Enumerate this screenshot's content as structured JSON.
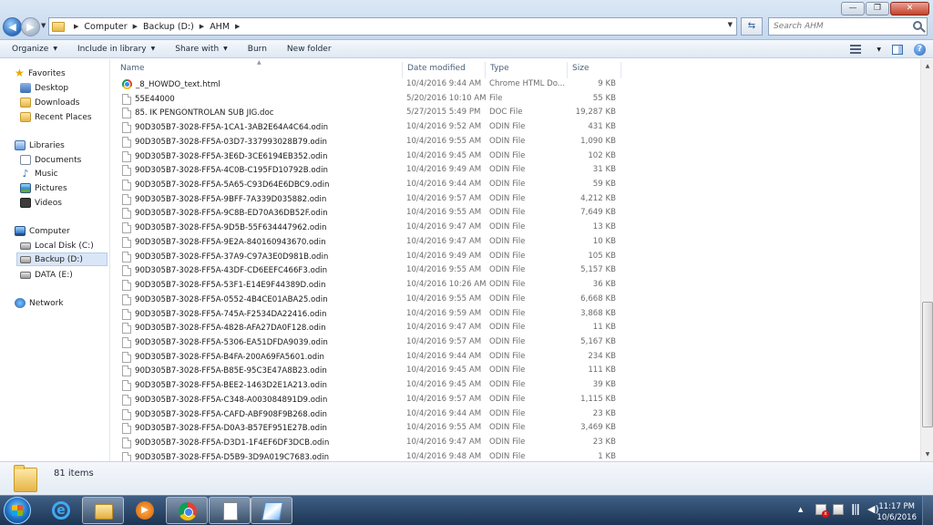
{
  "window": {
    "address_crumbs": [
      "Computer",
      "Backup (D:)",
      "AHM"
    ],
    "search_placeholder": "Search AHM",
    "controls": {
      "minimize": "—",
      "maximize": "❐",
      "close": "✕"
    }
  },
  "toolbar": {
    "organize": "Organize",
    "include_in_library": "Include in library",
    "share_with": "Share with",
    "burn": "Burn",
    "new_folder": "New folder",
    "help": "?"
  },
  "navpane": {
    "favorites": "Favorites",
    "desktop": "Desktop",
    "downloads": "Downloads",
    "recent_places": "Recent Places",
    "libraries": "Libraries",
    "documents": "Documents",
    "music": "Music",
    "pictures": "Pictures",
    "videos": "Videos",
    "computer": "Computer",
    "local_disk": "Local Disk (C:)",
    "backup": "Backup (D:)",
    "data": "DATA (E:)",
    "network": "Network"
  },
  "columns": {
    "name": "Name",
    "date": "Date modified",
    "type": "Type",
    "size": "Size"
  },
  "files": [
    {
      "name": "_8_HOWDO_text.html",
      "date": "10/4/2016 9:44 AM",
      "type": "Chrome HTML Do...",
      "size": "9 KB",
      "icon": "chrome-file-icon"
    },
    {
      "name": "55E44000",
      "date": "5/20/2016 10:10 AM",
      "type": "File",
      "size": "55 KB",
      "icon": "file-icon"
    },
    {
      "name": "85. IK PENGONTROLAN SUB JIG.doc",
      "date": "5/27/2015 5:49 PM",
      "type": "DOC File",
      "size": "19,287 KB",
      "icon": "file-icon"
    },
    {
      "name": "90D305B7-3028-FF5A-1CA1-3AB2E64A4C64.odin",
      "date": "10/4/2016 9:52 AM",
      "type": "ODIN File",
      "size": "431 KB",
      "icon": "file-icon"
    },
    {
      "name": "90D305B7-3028-FF5A-03D7-337993028B79.odin",
      "date": "10/4/2016 9:55 AM",
      "type": "ODIN File",
      "size": "1,090 KB",
      "icon": "file-icon"
    },
    {
      "name": "90D305B7-3028-FF5A-3E6D-3CE6194EB352.odin",
      "date": "10/4/2016 9:45 AM",
      "type": "ODIN File",
      "size": "102 KB",
      "icon": "file-icon"
    },
    {
      "name": "90D305B7-3028-FF5A-4C0B-C195FD10792B.odin",
      "date": "10/4/2016 9:49 AM",
      "type": "ODIN File",
      "size": "31 KB",
      "icon": "file-icon"
    },
    {
      "name": "90D305B7-3028-FF5A-5A65-C93D64E6DBC9.odin",
      "date": "10/4/2016 9:44 AM",
      "type": "ODIN File",
      "size": "59 KB",
      "icon": "file-icon"
    },
    {
      "name": "90D305B7-3028-FF5A-9BFF-7A339D035882.odin",
      "date": "10/4/2016 9:57 AM",
      "type": "ODIN File",
      "size": "4,212 KB",
      "icon": "file-icon"
    },
    {
      "name": "90D305B7-3028-FF5A-9C8B-ED70A36DB52F.odin",
      "date": "10/4/2016 9:55 AM",
      "type": "ODIN File",
      "size": "7,649 KB",
      "icon": "file-icon"
    },
    {
      "name": "90D305B7-3028-FF5A-9D5B-55F634447962.odin",
      "date": "10/4/2016 9:47 AM",
      "type": "ODIN File",
      "size": "13 KB",
      "icon": "file-icon"
    },
    {
      "name": "90D305B7-3028-FF5A-9E2A-840160943670.odin",
      "date": "10/4/2016 9:47 AM",
      "type": "ODIN File",
      "size": "10 KB",
      "icon": "file-icon"
    },
    {
      "name": "90D305B7-3028-FF5A-37A9-C97A3E0D981B.odin",
      "date": "10/4/2016 9:49 AM",
      "type": "ODIN File",
      "size": "105 KB",
      "icon": "file-icon"
    },
    {
      "name": "90D305B7-3028-FF5A-43DF-CD6EEFC466F3.odin",
      "date": "10/4/2016 9:55 AM",
      "type": "ODIN File",
      "size": "5,157 KB",
      "icon": "file-icon"
    },
    {
      "name": "90D305B7-3028-FF5A-53F1-E14E9F44389D.odin",
      "date": "10/4/2016 10:26 AM",
      "type": "ODIN File",
      "size": "36 KB",
      "icon": "file-icon"
    },
    {
      "name": "90D305B7-3028-FF5A-0552-4B4CE01ABA25.odin",
      "date": "10/4/2016 9:55 AM",
      "type": "ODIN File",
      "size": "6,668 KB",
      "icon": "file-icon"
    },
    {
      "name": "90D305B7-3028-FF5A-745A-F2534DA22416.odin",
      "date": "10/4/2016 9:59 AM",
      "type": "ODIN File",
      "size": "3,868 KB",
      "icon": "file-icon"
    },
    {
      "name": "90D305B7-3028-FF5A-4828-AFA27DA0F128.odin",
      "date": "10/4/2016 9:47 AM",
      "type": "ODIN File",
      "size": "11 KB",
      "icon": "file-icon"
    },
    {
      "name": "90D305B7-3028-FF5A-5306-EA51DFDA9039.odin",
      "date": "10/4/2016 9:57 AM",
      "type": "ODIN File",
      "size": "5,167 KB",
      "icon": "file-icon"
    },
    {
      "name": "90D305B7-3028-FF5A-B4FA-200A69FA5601.odin",
      "date": "10/4/2016 9:44 AM",
      "type": "ODIN File",
      "size": "234 KB",
      "icon": "file-icon"
    },
    {
      "name": "90D305B7-3028-FF5A-B85E-95C3E47A8B23.odin",
      "date": "10/4/2016 9:45 AM",
      "type": "ODIN File",
      "size": "111 KB",
      "icon": "file-icon"
    },
    {
      "name": "90D305B7-3028-FF5A-BEE2-1463D2E1A213.odin",
      "date": "10/4/2016 9:45 AM",
      "type": "ODIN File",
      "size": "39 KB",
      "icon": "file-icon"
    },
    {
      "name": "90D305B7-3028-FF5A-C348-A003084891D9.odin",
      "date": "10/4/2016 9:57 AM",
      "type": "ODIN File",
      "size": "1,115 KB",
      "icon": "file-icon"
    },
    {
      "name": "90D305B7-3028-FF5A-CAFD-ABF908F9B268.odin",
      "date": "10/4/2016 9:44 AM",
      "type": "ODIN File",
      "size": "23 KB",
      "icon": "file-icon"
    },
    {
      "name": "90D305B7-3028-FF5A-D0A3-B57EF951E27B.odin",
      "date": "10/4/2016 9:55 AM",
      "type": "ODIN File",
      "size": "3,469 KB",
      "icon": "file-icon"
    },
    {
      "name": "90D305B7-3028-FF5A-D3D1-1F4EF6DF3DCB.odin",
      "date": "10/4/2016 9:47 AM",
      "type": "ODIN File",
      "size": "23 KB",
      "icon": "file-icon"
    },
    {
      "name": "90D305B7-3028-FF5A-D5B9-3D9A019C7683.odin",
      "date": "10/4/2016 9:48 AM",
      "type": "ODIN File",
      "size": "1 KB",
      "icon": "file-icon"
    }
  ],
  "details": {
    "item_count": "81 items"
  },
  "taskbar": {
    "apps": [
      "internet-explorer-icon",
      "windows-explorer-icon",
      "media-player-icon",
      "chrome-icon",
      "document-icon",
      "paint-icon"
    ],
    "time": "11:17 PM",
    "date": "10/6/2016"
  }
}
